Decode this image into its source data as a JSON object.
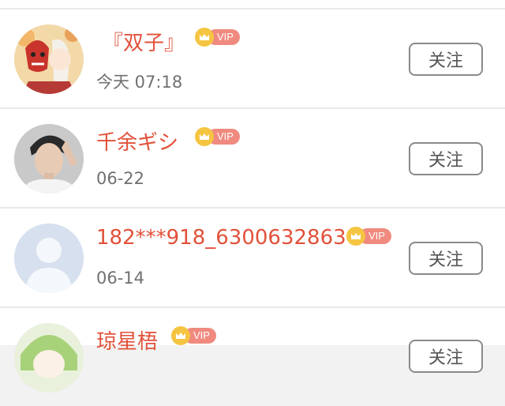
{
  "follow_label": "关注",
  "vip_label": "VIP",
  "colors": {
    "name": "#e2513a",
    "vip_badge": "#f08a7f",
    "crown": "#f5c542",
    "time": "#707070",
    "divider": "#e9e9e9"
  },
  "users": [
    {
      "name": "『双子』",
      "time": "今天 07:18",
      "avatar": "anime-oni-mask-avatar"
    },
    {
      "name": "千余ギシ",
      "time": "06-22",
      "avatar": "person-photo-avatar"
    },
    {
      "name": "182***918_6300632863",
      "time": "06-14",
      "avatar": "default-user-silhouette-avatar"
    },
    {
      "name": "琼星梧",
      "time": "",
      "avatar": "anime-green-hair-avatar"
    }
  ]
}
